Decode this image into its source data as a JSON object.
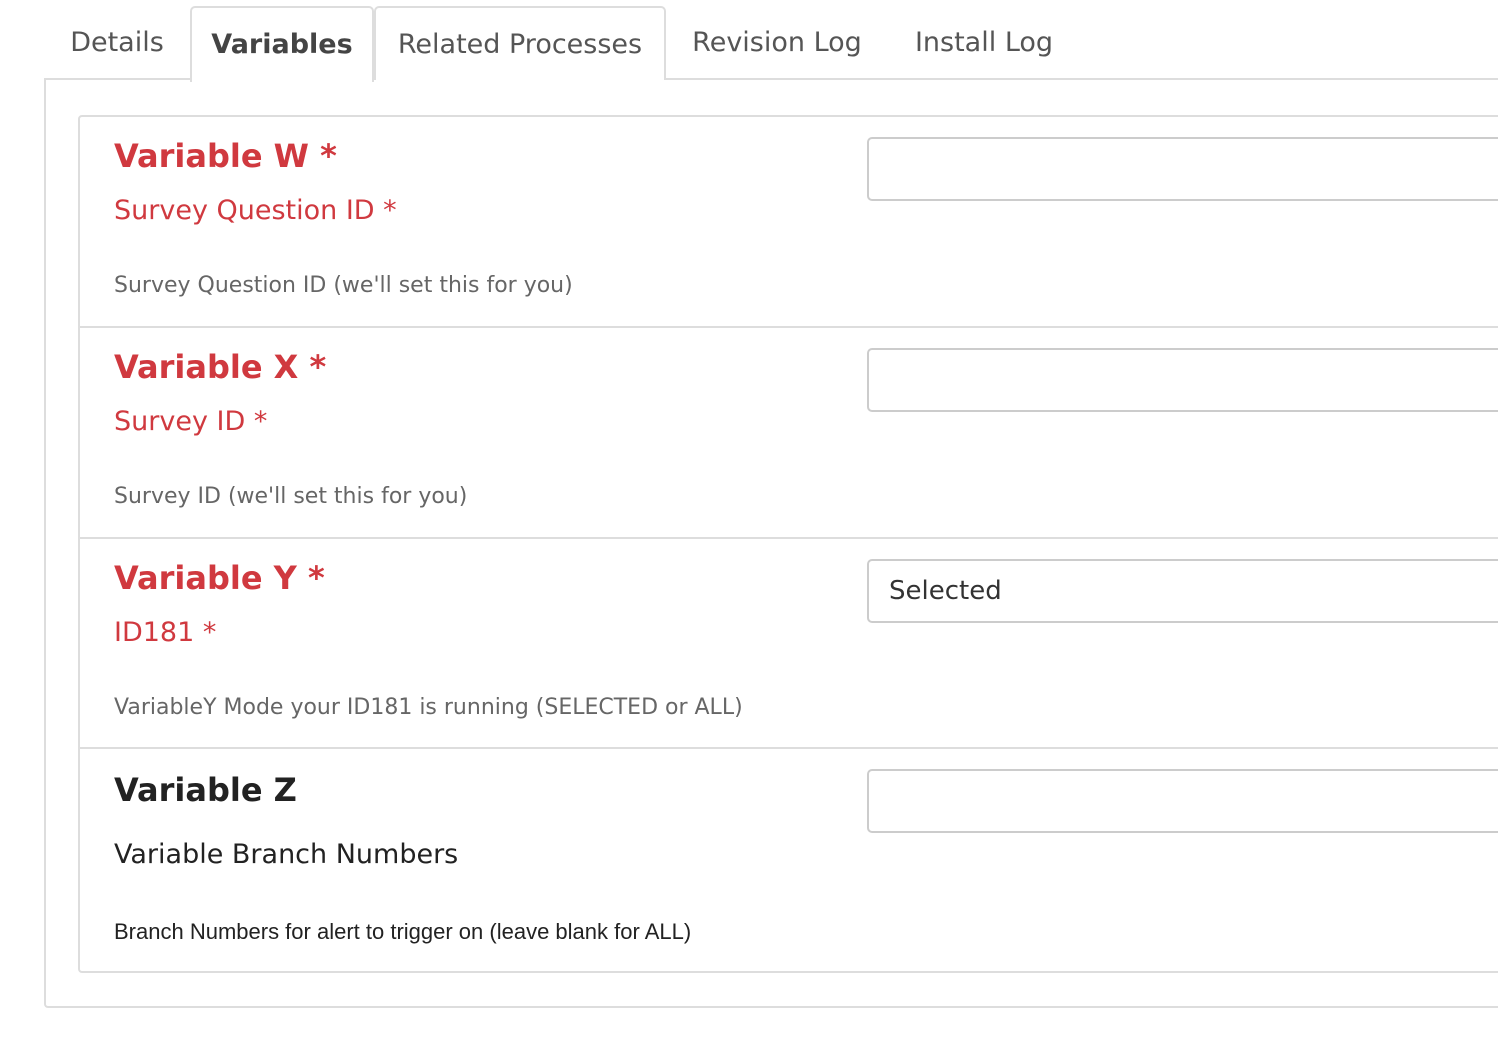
{
  "tabs": [
    {
      "label": "Details",
      "active": false
    },
    {
      "label": "Variables",
      "active": true
    },
    {
      "label": "Related Processes",
      "active": false
    },
    {
      "label": "Revision Log",
      "active": false
    },
    {
      "label": "Install Log",
      "active": false
    }
  ],
  "variables": [
    {
      "title": "Variable W *",
      "subtitle": "Survey Question ID *",
      "help": "Survey Question ID (we'll set this for you)",
      "value": "",
      "required": true
    },
    {
      "title": "Variable X *",
      "subtitle": "Survey ID *",
      "help": "Survey ID (we'll set this for you)",
      "value": "",
      "required": true
    },
    {
      "title": "Variable Y *",
      "subtitle": "ID181 *",
      "help": "VariableY Mode your ID181 is running (SELECTED or ALL)",
      "value": "Selected",
      "required": true
    },
    {
      "title": "Variable Z",
      "subtitle": "Variable Branch Numbers",
      "help": "Branch Numbers for alert to trigger on (leave blank for ALL)",
      "value": "",
      "required": false
    }
  ],
  "colors": {
    "required": "#d0393f",
    "border": "#dddddd",
    "input_border": "#cccccc"
  }
}
